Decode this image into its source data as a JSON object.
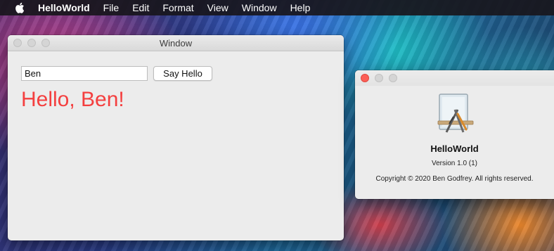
{
  "menubar": {
    "apple_icon": "apple-logo-icon",
    "app_name": "HelloWorld",
    "items": [
      "File",
      "Edit",
      "Format",
      "View",
      "Window",
      "Help"
    ]
  },
  "main_window": {
    "title": "Window",
    "name_field": {
      "value": "Ben"
    },
    "say_hello_button": "Say Hello",
    "greeting": "Hello, Ben!",
    "greeting_color": "#f43f3f"
  },
  "about_window": {
    "app_icon": "xcode-app-icon",
    "app_name": "HelloWorld",
    "version": "Version 1.0 (1)",
    "copyright": "Copyright © 2020 Ben Godfrey. All rights reserved."
  }
}
